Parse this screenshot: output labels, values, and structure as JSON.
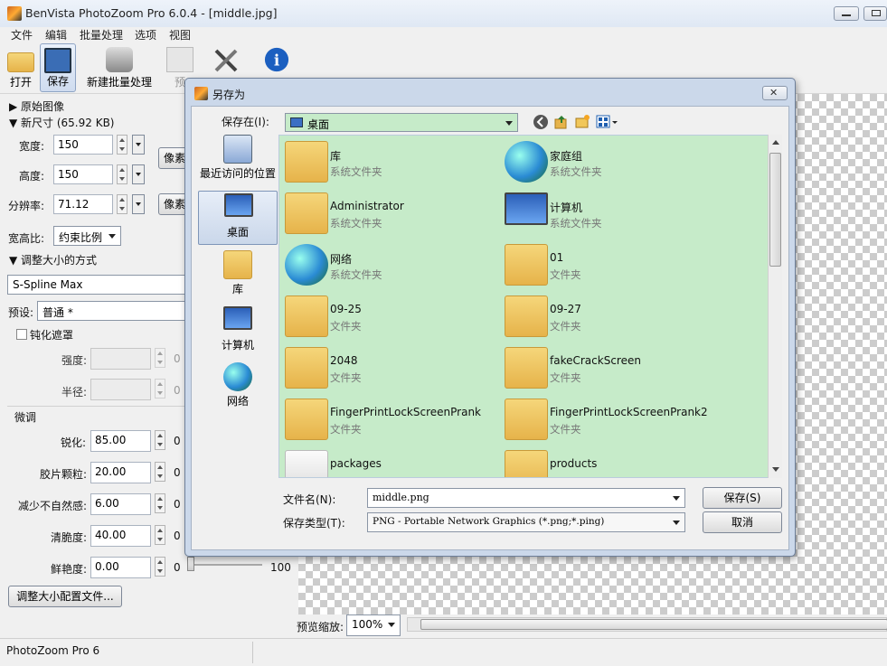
{
  "app": {
    "title": "BenVista PhotoZoom Pro 6.0.4 - [middle.jpg]"
  },
  "menu": [
    "文件",
    "编辑",
    "批量处理",
    "选项",
    "视图"
  ],
  "toolbar": {
    "open_label": "打开",
    "save_label": "保存",
    "new_batch_label": "新建批量处理",
    "preview_label": "预"
  },
  "left": {
    "original_image": "▶ 原始图像",
    "new_size": "▼ 新尺寸 (65.92 KB)",
    "width_label": "宽度:",
    "width_value": "150",
    "height_label": "高度:",
    "height_value": "150",
    "resolution_label": "分辨率:",
    "resolution_value": "71.12",
    "unit_button_1": "像素",
    "unit_button_2": "像素",
    "aspect_label": "宽高比:",
    "aspect_value": "约束比例",
    "resize_method_header": "▼ 调整大小的方式",
    "method_value": "S-Spline Max",
    "preset_label": "预设:",
    "preset_value": "普通 *",
    "unsharp_label": "钝化遮罩",
    "strength_label": "强度:",
    "radius_label": "半径:",
    "fine_tune_label": "微调",
    "sharpen_label": "锐化:",
    "sharpen_value": "85.00",
    "film_grain_label": "胶片颗粒:",
    "film_grain_value": "20.00",
    "reduce_artifacts_label": "减少不自然感:",
    "reduce_artifacts_value": "6.00",
    "crispness_label": "清脆度:",
    "crispness_value": "40.00",
    "vividness_label": "鲜艳度:",
    "vividness_value": "0.00",
    "zero": "0",
    "slider_max": "100",
    "profile_button": "调整大小配置文件..."
  },
  "zoom": {
    "label": "预览缩放:",
    "value": "100%"
  },
  "status": {
    "text": "PhotoZoom Pro 6"
  },
  "dialog": {
    "title": "另存为",
    "save_in_label": "保存在(I):",
    "save_in_value": "桌面",
    "places": [
      "最近访问的位置",
      "桌面",
      "库",
      "计算机",
      "网络"
    ],
    "files": [
      {
        "name": "库",
        "type": "系统文件夹"
      },
      {
        "name": "家庭组",
        "type": "系统文件夹"
      },
      {
        "name": "Administrator",
        "type": "系统文件夹"
      },
      {
        "name": "计算机",
        "type": "系统文件夹"
      },
      {
        "name": "网络",
        "type": "系统文件夹"
      },
      {
        "name": "01",
        "type": "文件夹"
      },
      {
        "name": "09-25",
        "type": "文件夹"
      },
      {
        "name": "09-27",
        "type": "文件夹"
      },
      {
        "name": "2048",
        "type": "文件夹"
      },
      {
        "name": "fakeCrackScreen",
        "type": "文件夹"
      },
      {
        "name": "FingerPrintLockScreenPrank",
        "type": "文件夹"
      },
      {
        "name": "FingerPrintLockScreenPrank2",
        "type": "文件夹"
      },
      {
        "name": "packages",
        "type": ""
      },
      {
        "name": "products",
        "type": ""
      }
    ],
    "filename_label": "文件名(N):",
    "filename_value": "middle.png",
    "filetype_label": "保存类型(T):",
    "filetype_value": "PNG - Portable Network Graphics (*.png;*.ping)",
    "save_button": "保存(S)",
    "cancel_button": "取消"
  }
}
